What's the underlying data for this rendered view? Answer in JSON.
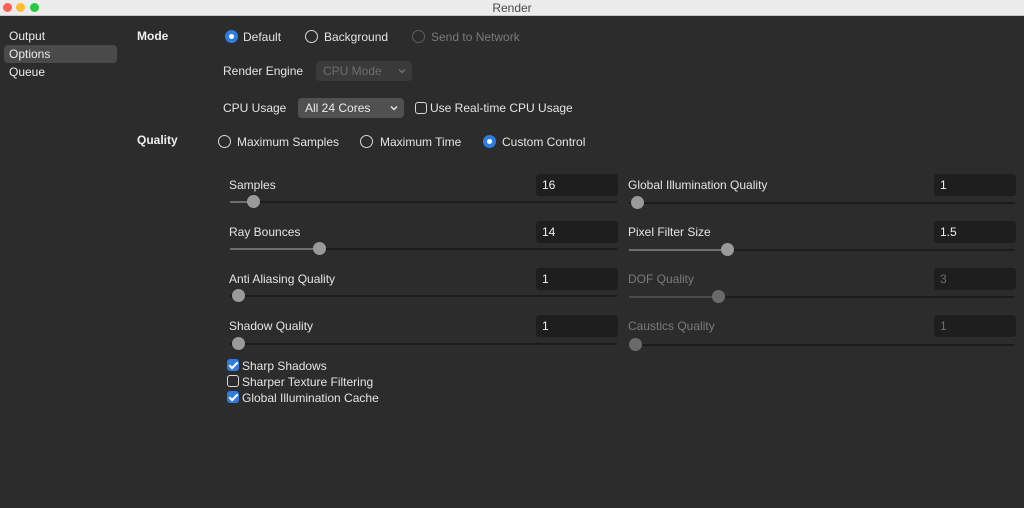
{
  "window": {
    "title": "Render"
  },
  "sidebar": {
    "items": [
      "Output",
      "Options",
      "Queue"
    ],
    "selected": "Options"
  },
  "mode": {
    "section_label": "Mode",
    "options": [
      "Default",
      "Background",
      "Send to Network"
    ],
    "selected": "Default",
    "render_engine_label": "Render Engine",
    "render_engine_value": "CPU Mode",
    "cpu_usage_label": "CPU Usage",
    "cpu_usage_value": "All 24 Cores",
    "realtime_label": "Use Real-time CPU Usage",
    "realtime_checked": false
  },
  "quality": {
    "section_label": "Quality",
    "options": [
      "Maximum Samples",
      "Maximum Time",
      "Custom Control"
    ],
    "selected": "Custom Control",
    "left_sliders": [
      {
        "label": "Samples",
        "value": "16",
        "level": 0.06,
        "enabled": true
      },
      {
        "label": "Ray Bounces",
        "value": "14",
        "level": 0.23,
        "enabled": true
      },
      {
        "label": "Anti Aliasing Quality",
        "value": "1",
        "level": 0.0,
        "enabled": true
      },
      {
        "label": "Shadow Quality",
        "value": "1",
        "level": 0.0,
        "enabled": true
      }
    ],
    "right_sliders": [
      {
        "label": "Global Illumination Quality",
        "value": "1",
        "level": 0.0,
        "enabled": true
      },
      {
        "label": "Pixel Filter Size",
        "value": "1.5",
        "level": 0.25,
        "enabled": true
      },
      {
        "label": "DOF Quality",
        "value": "3",
        "level": 0.23,
        "enabled": false
      },
      {
        "label": "Caustics Quality",
        "value": "1",
        "level": 0.0,
        "enabled": false
      }
    ],
    "checkboxes": [
      {
        "label": "Sharp Shadows",
        "checked": true
      },
      {
        "label": "Sharper Texture Filtering",
        "checked": false
      },
      {
        "label": "Global Illumination Cache",
        "checked": true
      }
    ]
  },
  "colors": {
    "accent": "#2f7de1",
    "background": "#2c2c2c",
    "field": "#1e1e1e"
  }
}
